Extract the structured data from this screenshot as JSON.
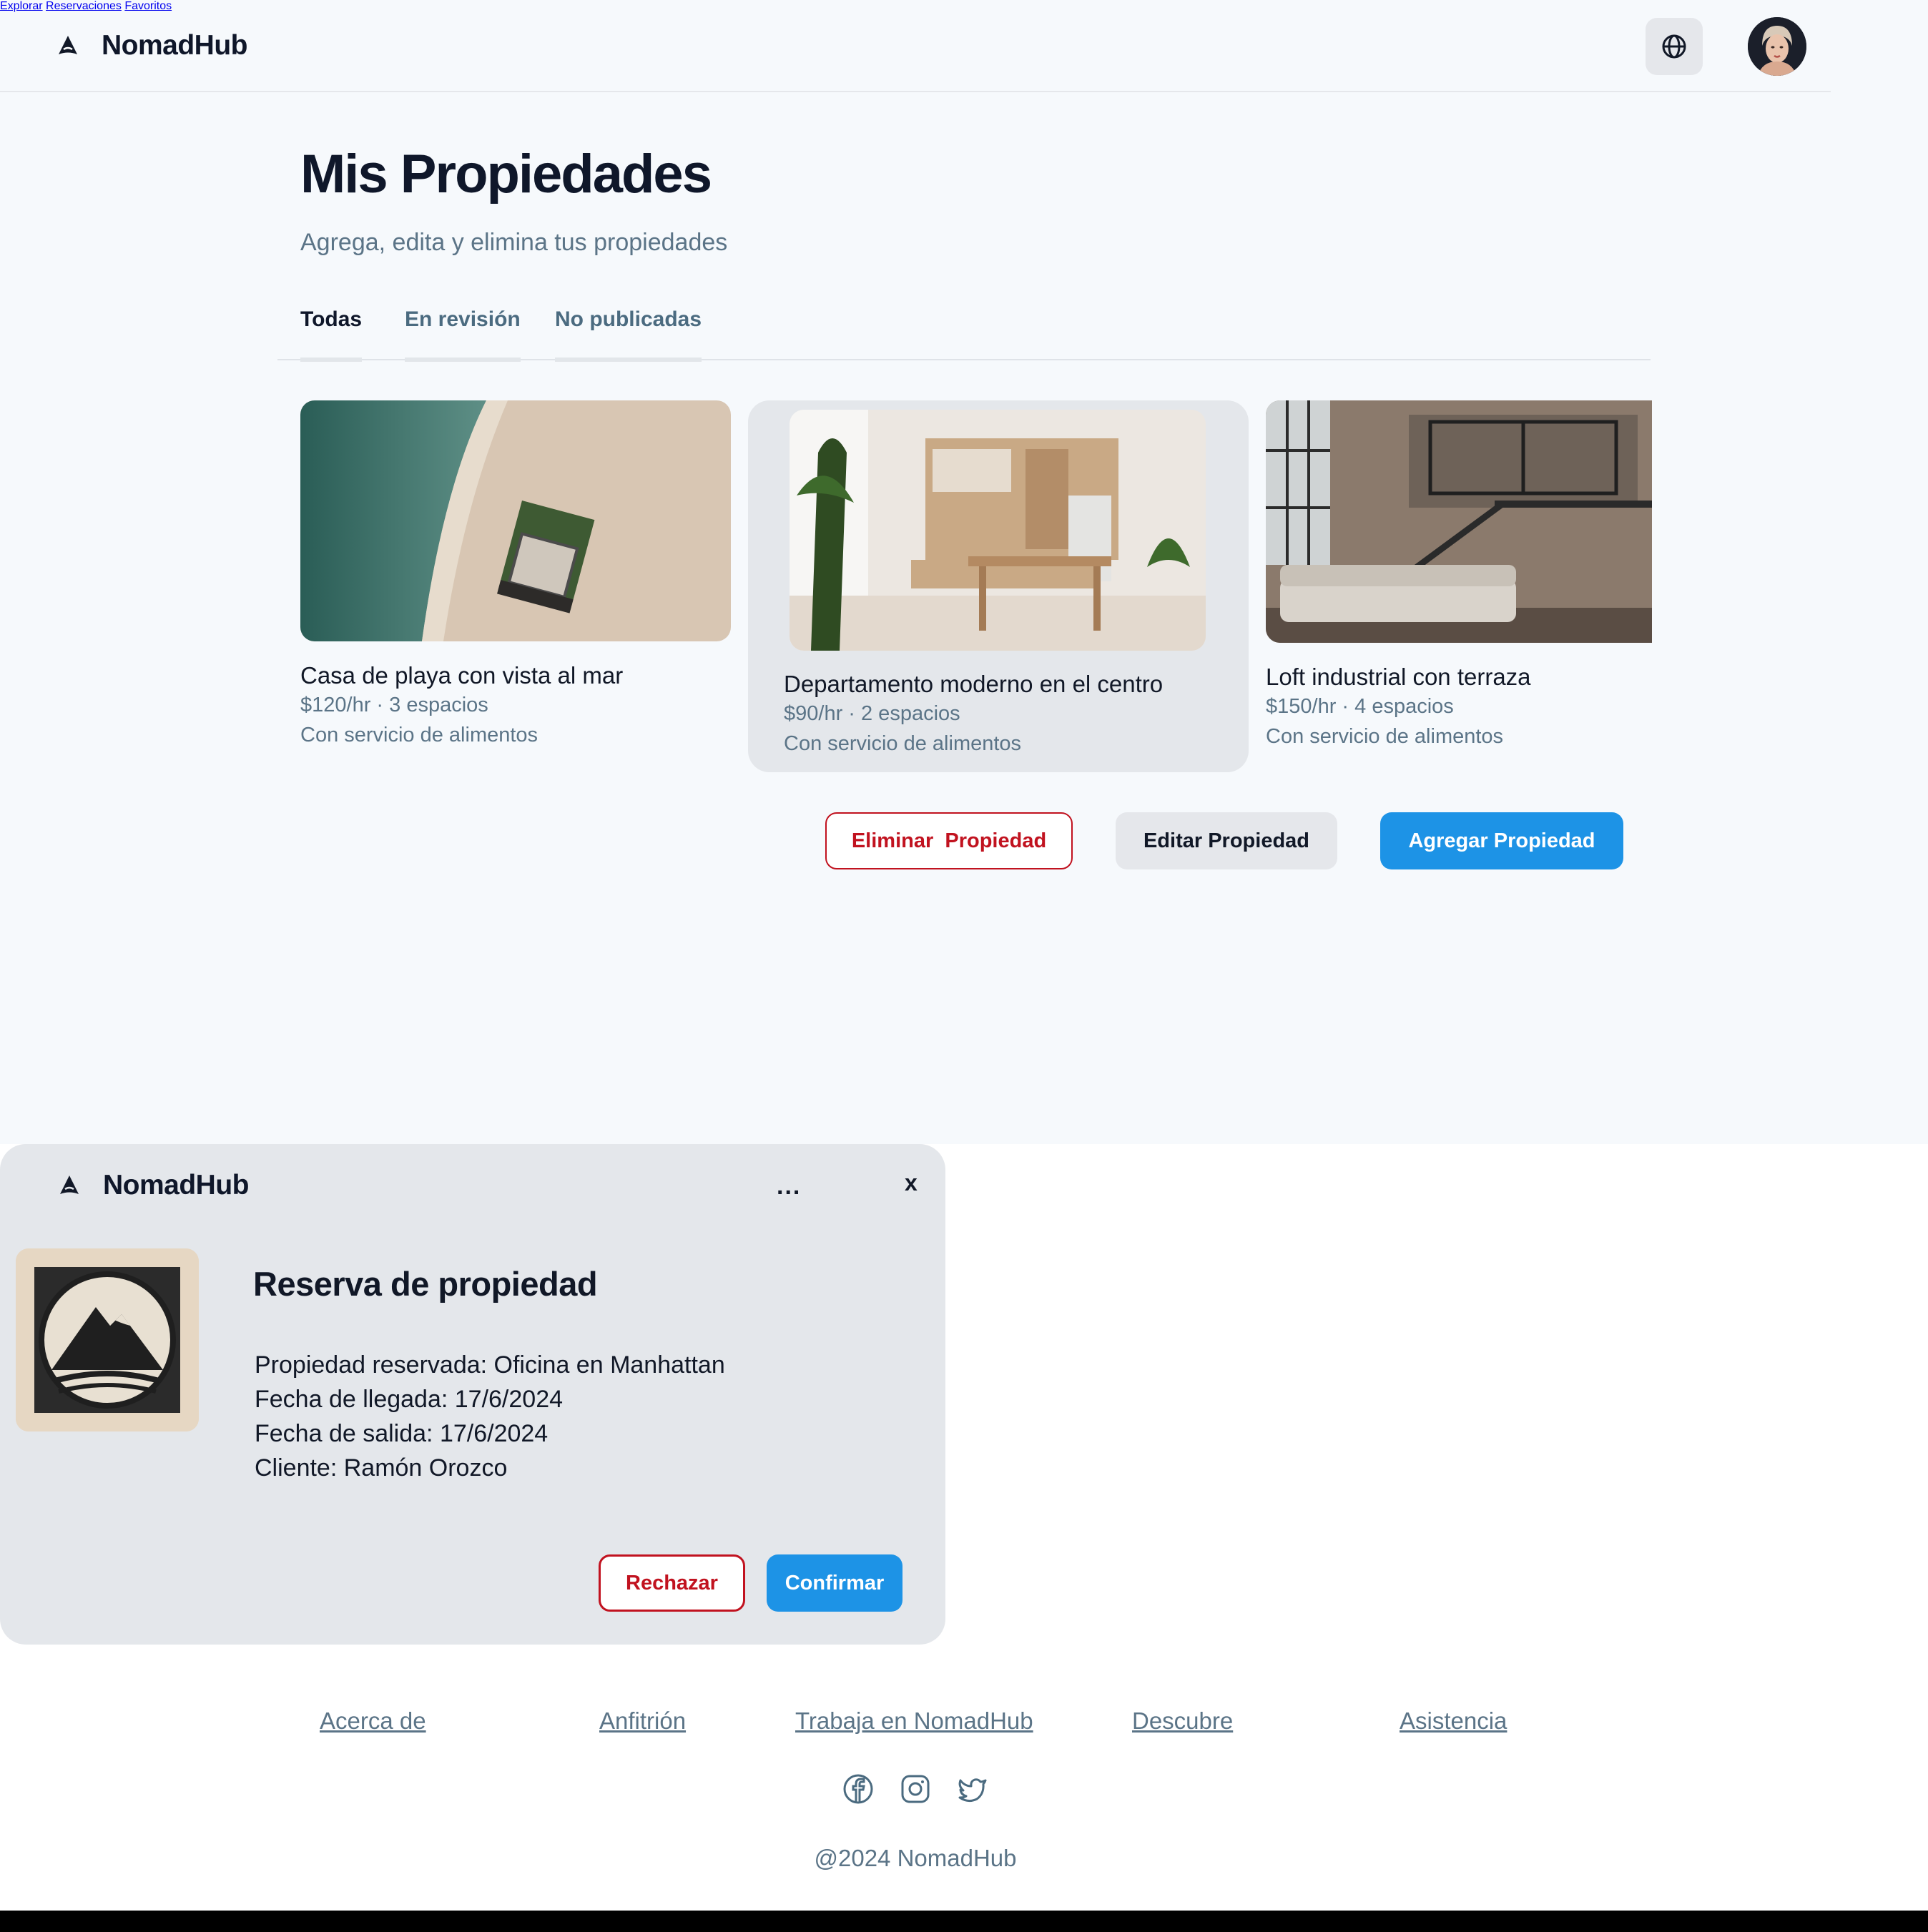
{
  "app": {
    "name": "NomadHub"
  },
  "nav": {
    "items": [
      "Explorar",
      "Reservaciones",
      "Favoritos"
    ],
    "language_icon": "globe-icon",
    "avatar_icon": "user-avatar"
  },
  "page": {
    "title": "Mis Propiedades",
    "subtitle": "Agrega, edita y elimina tus propiedades"
  },
  "tabs": [
    {
      "label": "Todas",
      "active": true
    },
    {
      "label": "En revisión",
      "active": false
    },
    {
      "label": "No publicadas",
      "active": false
    }
  ],
  "properties": [
    {
      "title": "Casa de playa con vista al mar",
      "price_spaces": "$120/hr · 3 espacios",
      "food": "Con servicio de alimentos",
      "selected": false
    },
    {
      "title": "Departamento moderno en el centro",
      "price_spaces": "$90/hr · 2 espacios",
      "food": "Con servicio de alimentos",
      "selected": true
    },
    {
      "title": "Loft industrial con terraza",
      "price_spaces": "$150/hr · 4 espacios",
      "food": "Con servicio de alimentos",
      "selected": false
    }
  ],
  "actions": {
    "delete": "Eliminar  Propiedad",
    "edit": "Editar Propiedad",
    "add": "Agregar Propiedad"
  },
  "notification": {
    "brand": "NomadHub",
    "more": "...",
    "close": "x",
    "title": "Reserva de propiedad",
    "lines": [
      {
        "label": "Propiedad reservada:",
        "value": " Oficina en Manhattan"
      },
      {
        "label": "Fecha de llegada:",
        "value": " 17/6/2024"
      },
      {
        "label": "Fecha de salida:",
        "value": " 17/6/2024"
      },
      {
        "label": "Cliente:",
        "value": " Ramón Orozco"
      }
    ],
    "reject": "Rechazar",
    "confirm": "Confirmar"
  },
  "footer": {
    "links": [
      "Acerca de",
      "Anfitrión",
      "Trabaja en NomadHub",
      "Descubre",
      "Asistencia"
    ],
    "social_icons": [
      "facebook-icon",
      "instagram-icon",
      "twitter-icon"
    ],
    "copyright": "@2024 NomadHub"
  },
  "colors": {
    "accent": "#1d93e6",
    "danger": "#c1121f",
    "muted_text": "#5b7487",
    "page_bg": "#f6f9fc",
    "panel_bg": "#e4e7eb"
  }
}
